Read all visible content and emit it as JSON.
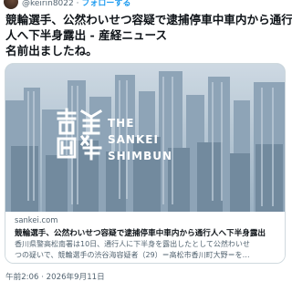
{
  "header": {
    "handle": "@keirin8022",
    "separator": " · ",
    "follow_label": "フォローする"
  },
  "tweet": {
    "lines": [
      "競輪選手、公然わいせつ容疑で逮捕停車中車内から通行",
      "人へ下半身露出 - 産経ニュース",
      "名前出ましたね。"
    ]
  },
  "card": {
    "logo_text_lines": [
      "THE",
      "SANKEI",
      "SHIMBUN"
    ],
    "domain": "sankei.com",
    "title": "競輪選手、公然わいせつ容疑で逮捕停車中車内から通行人へ下半身露出",
    "description_lines": [
      "香川県警高松南署は10日、通行人に下半身を露出したとして公然わいせ",
      "つの疑いで、競輪選手の渋谷海容疑者（29）＝高松市香川町大野＝を…"
    ]
  },
  "timestamp": "午前2:06 · 2026年9月11日",
  "colors": {
    "follow": "#1d9bf0",
    "secondary_text": "#536471",
    "card_border": "#cfd9de"
  }
}
